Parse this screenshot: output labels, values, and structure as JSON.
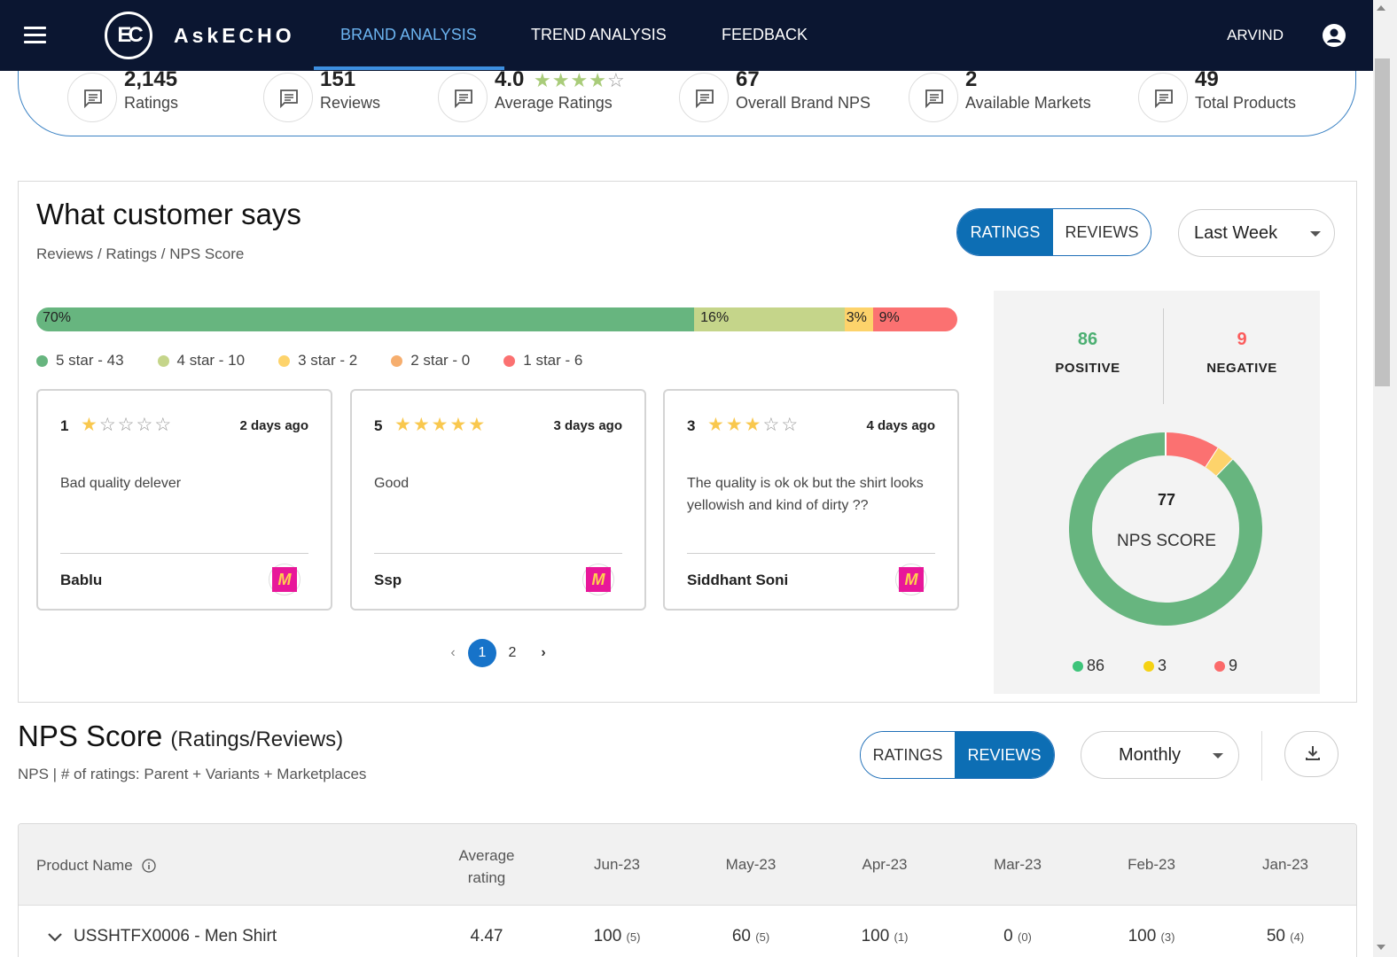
{
  "nav": {
    "brand": "AskECHO",
    "logo_text": "EC",
    "tabs": [
      {
        "label": "BRAND ANALYSIS",
        "active": true
      },
      {
        "label": "TREND ANALYSIS",
        "active": false
      },
      {
        "label": "FEEDBACK",
        "active": false
      }
    ],
    "user": "ARVIND"
  },
  "stats": [
    {
      "value": "2,145",
      "label": "Ratings"
    },
    {
      "value": "151",
      "label": "Reviews"
    },
    {
      "value": "4.0",
      "label": "Average Ratings",
      "stars": 4
    },
    {
      "value": "67",
      "label": "Overall Brand NPS"
    },
    {
      "value": "2",
      "label": "Available Markets"
    },
    {
      "value": "49",
      "label": "Total Products"
    }
  ],
  "customer": {
    "title": "What customer says",
    "subtitle": "Reviews / Ratings / NPS Score",
    "toggle": {
      "ratings": "RATINGS",
      "reviews": "REVIEWS",
      "selected": "RATINGS"
    },
    "period": "Last Week",
    "distribution": [
      {
        "label": "70%",
        "pct": 70,
        "color": "#67b57f"
      },
      {
        "label": "16%",
        "pct": 16,
        "color": "#c5d58a"
      },
      {
        "label": "3%",
        "pct": 3,
        "color": "#fdd36b"
      },
      {
        "label": "9%",
        "pct": 9,
        "color": "#fb7171"
      }
    ],
    "legend": [
      {
        "label": "5 star - 43",
        "color": "#67b57f"
      },
      {
        "label": "4 star - 10",
        "color": "#c5d58a"
      },
      {
        "label": "3 star - 2",
        "color": "#fdd36b"
      },
      {
        "label": "2 star - 0",
        "color": "#f6ae6e"
      },
      {
        "label": "1 star - 6",
        "color": "#fb7171"
      }
    ],
    "reviews": [
      {
        "rating": "1",
        "stars": 1,
        "ago": "2 days ago",
        "text": "Bad quality delever",
        "name": "Bablu"
      },
      {
        "rating": "5",
        "stars": 5,
        "ago": "3 days ago",
        "text": "Good",
        "name": "Ssp"
      },
      {
        "rating": "3",
        "stars": 3,
        "ago": "4 days ago",
        "text": "The quality is ok ok but the shirt looks yellowish and kind of dirty ??",
        "name": "Siddhant Soni"
      }
    ],
    "pager": {
      "pages": [
        "1",
        "2"
      ],
      "current": "1"
    },
    "nps": {
      "positive_value": "86",
      "positive_label": "POSITIVE",
      "negative_value": "9",
      "negative_label": "NEGATIVE",
      "score": "77",
      "score_label": "NPS SCORE",
      "donut": [
        {
          "value": 86,
          "label": "86",
          "color": "#67b57f"
        },
        {
          "value": 3,
          "label": "3",
          "color": "#fdd36b"
        },
        {
          "value": 9,
          "label": "9",
          "color": "#fb7171"
        }
      ],
      "positive_color": "#4caf72",
      "negative_color": "#fb5c5c"
    }
  },
  "nps_section": {
    "title": "NPS Score",
    "title_suffix": "(Ratings/Reviews)",
    "subtitle": "NPS | # of ratings: Parent + Variants + Marketplaces",
    "toggle": {
      "ratings": "RATINGS",
      "reviews": "REVIEWS",
      "selected": "REVIEWS"
    },
    "period": "Monthly",
    "columns": [
      "Product Name",
      "Average rating",
      "Jun-23",
      "May-23",
      "Apr-23",
      "Mar-23",
      "Feb-23",
      "Jan-23"
    ],
    "rows": [
      {
        "product": "USSHTFX0006 - Men Shirt",
        "avg": "4.47",
        "cells": [
          {
            "v": "100",
            "n": "(5)"
          },
          {
            "v": "60",
            "n": "(5)"
          },
          {
            "v": "100",
            "n": "(1)"
          },
          {
            "v": "0",
            "n": "(0)"
          },
          {
            "v": "100",
            "n": "(3)"
          },
          {
            "v": "50",
            "n": "(4)"
          }
        ]
      }
    ]
  }
}
